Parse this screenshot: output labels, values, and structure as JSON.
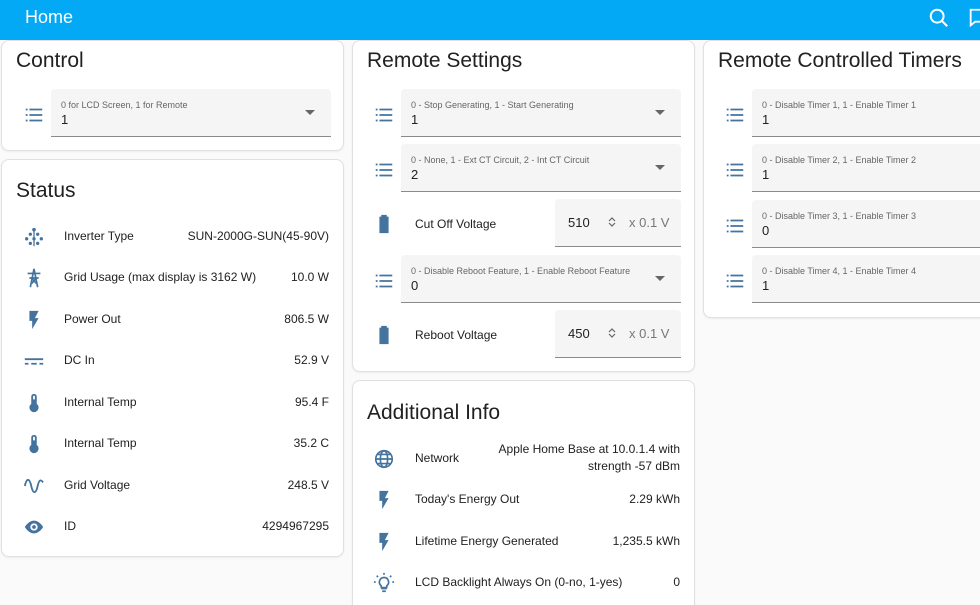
{
  "header": {
    "title": "Home"
  },
  "control": {
    "title": "Control",
    "select": {
      "label": "0 for LCD Screen, 1 for Remote",
      "value": "1"
    }
  },
  "status": {
    "title": "Status",
    "rows": [
      {
        "icon": "solar-tree-icon",
        "label": "Inverter Type",
        "value": "SUN-2000G-SUN(45-90V)"
      },
      {
        "icon": "transmission-tower-icon",
        "label": "Grid Usage (max display is 3162 W)",
        "value": "10.0 W"
      },
      {
        "icon": "flash-icon",
        "label": "Power Out",
        "value": "806.5 W"
      },
      {
        "icon": "current-dc-icon",
        "label": "DC In",
        "value": "52.9 V"
      },
      {
        "icon": "thermometer-icon",
        "label": "Internal Temp",
        "value": "95.4 F"
      },
      {
        "icon": "thermometer-icon",
        "label": "Internal Temp",
        "value": "35.2 C"
      },
      {
        "icon": "sine-wave-icon",
        "label": "Grid Voltage",
        "value": "248.5 V"
      },
      {
        "icon": "eye-icon",
        "label": "ID",
        "value": "4294967295"
      }
    ]
  },
  "remote_settings": {
    "title": "Remote Settings",
    "generating": {
      "label": "0 - Stop Generating, 1 - Start Generating",
      "value": "1"
    },
    "ct_circuit": {
      "label": "0 - None, 1 - Ext CT Circuit, 2 - Int CT Circuit",
      "value": "2"
    },
    "cutoff": {
      "label": "Cut Off Voltage",
      "value": "510",
      "unit": "x 0.1 V"
    },
    "reboot_feature": {
      "label": "0 - Disable Reboot Feature, 1 - Enable Reboot Feature",
      "value": "0"
    },
    "reboot_voltage": {
      "label": "Reboot Voltage",
      "value": "450",
      "unit": "x 0.1 V"
    }
  },
  "additional_info": {
    "title": "Additional Info",
    "network": {
      "label": "Network",
      "value_line1": "Apple Home Base at 10.0.1.4 with",
      "value_line2": "strength -57 dBm"
    },
    "rows": [
      {
        "icon": "flash-icon",
        "label": "Today's Energy Out",
        "value": "2.29 kWh"
      },
      {
        "icon": "flash-icon",
        "label": "Lifetime Energy Generated",
        "value": "1,235.5 kWh"
      },
      {
        "icon": "lightbulb-icon",
        "label": "LCD Backlight Always On (0-no, 1-yes)",
        "value": "0"
      }
    ]
  },
  "timers": {
    "title": "Remote Controlled Timers",
    "items": [
      {
        "label": "0 - Disable Timer 1, 1 - Enable Timer 1",
        "value": "1"
      },
      {
        "label": "0 - Disable Timer 2, 1 - Enable Timer 2",
        "value": "1"
      },
      {
        "label": "0 - Disable Timer 3, 1 - Enable Timer 3",
        "value": "0"
      },
      {
        "label": "0 - Disable Timer 4, 1 - Enable Timer 4",
        "value": "1"
      }
    ]
  },
  "colors": {
    "header": "#03a9f4",
    "icon": "#44739e"
  }
}
